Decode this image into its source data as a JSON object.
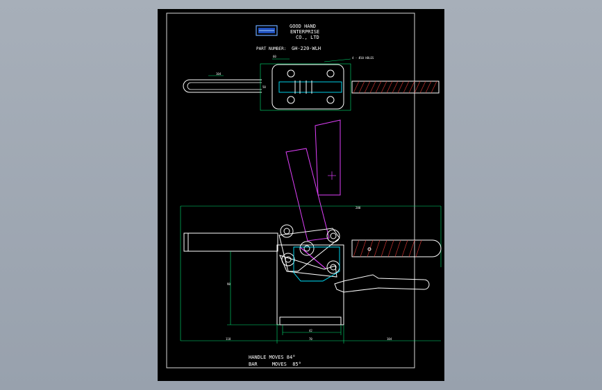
{
  "colors": {
    "background": "#9aa3af",
    "sheet": "#000000",
    "frame": "#d8d8d8",
    "outline": "#ffffff",
    "dimension": "#00e676",
    "cyan": "#00e5ff",
    "magenta": "#e040fb",
    "hatch": "#e53935",
    "title": "#6aa8ff"
  },
  "title_block": {
    "logo_icon": "company-logo",
    "company_line1": "GOOD HAND",
    "company_line2": "ENTERPRISE",
    "company_line3": "CO., LTD",
    "part_label": "PART NUMBER:",
    "part_number": "GH-220-WLH"
  },
  "dimensions": {
    "top_width": "60",
    "hole_note": "4 - Ø10 HOLES",
    "handle_offset": "104",
    "base_left_small": "50",
    "overall_width": "280",
    "height": "98",
    "bottom_left": "118",
    "bottom_mid": "70",
    "bottom_right": "104",
    "bottom_inner": "42"
  },
  "notes": {
    "handle_moves": "HANDLE MOVES 84°",
    "bar_moves": "BAR     MOVES  85°"
  }
}
